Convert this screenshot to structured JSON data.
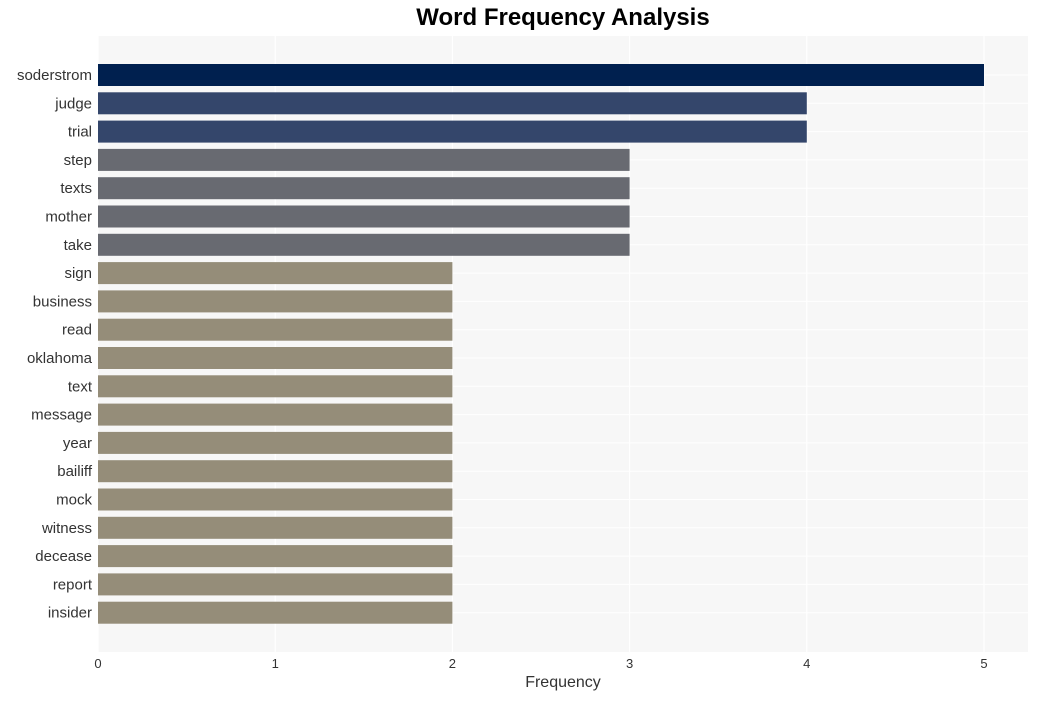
{
  "chart_data": {
    "type": "bar",
    "orientation": "horizontal",
    "title": "Word Frequency Analysis",
    "xlabel": "Frequency",
    "ylabel": "",
    "xlim": [
      0,
      5.25
    ],
    "xticks": [
      0,
      1,
      2,
      3,
      4,
      5
    ],
    "grid": true,
    "categories": [
      "soderstrom",
      "judge",
      "trial",
      "step",
      "texts",
      "mother",
      "take",
      "sign",
      "business",
      "read",
      "oklahoma",
      "text",
      "message",
      "year",
      "bailiff",
      "mock",
      "witness",
      "decease",
      "report",
      "insider"
    ],
    "values": [
      5,
      4,
      4,
      3,
      3,
      3,
      3,
      2,
      2,
      2,
      2,
      2,
      2,
      2,
      2,
      2,
      2,
      2,
      2,
      2
    ],
    "colors": {
      "5": "#00204f",
      "4": "#34466b",
      "3": "#686a71",
      "2": "#958d79"
    },
    "background": "#f7f7f7",
    "gridline_color": "#ffffff"
  }
}
